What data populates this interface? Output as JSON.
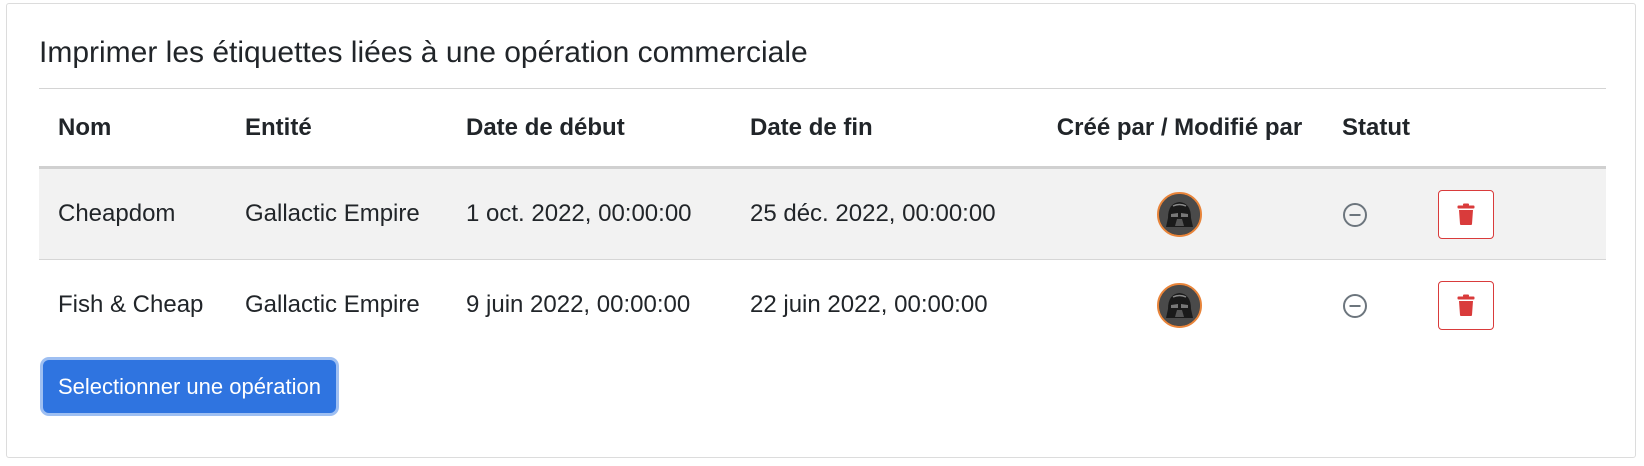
{
  "card": {
    "title": "Imprimer les étiquettes liées à une opération commerciale"
  },
  "table": {
    "columns": {
      "name": "Nom",
      "entity": "Entité",
      "start": "Date de début",
      "end": "Date de fin",
      "creator": "Créé par / Modifié par",
      "status": "Statut"
    },
    "rows": [
      {
        "name": "Cheapdom",
        "entity": "Gallactic Empire",
        "start": "1 oct. 2022, 00:00:00",
        "end": "25 déc. 2022, 00:00:00",
        "creator_icon": "avatar-helmet",
        "status_icon": "minus-circle-icon"
      },
      {
        "name": "Fish & Cheap",
        "entity": "Gallactic Empire",
        "start": "9 juin 2022, 00:00:00",
        "end": "22 juin 2022, 00:00:00",
        "creator_icon": "avatar-helmet",
        "status_icon": "minus-circle-icon"
      }
    ]
  },
  "actions": {
    "select_label": "Selectionner une opération"
  },
  "colors": {
    "primary": "#2f74e0",
    "danger": "#d93b3b",
    "avatar_border": "#e8843a",
    "row_stripe": "#f2f2f2"
  }
}
